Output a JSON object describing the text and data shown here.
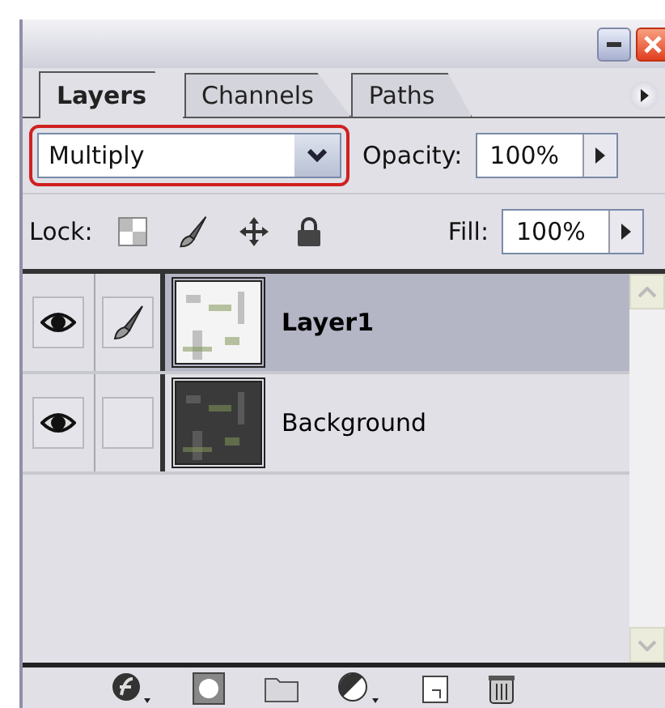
{
  "tabs": [
    {
      "label": "Layers",
      "selected": true
    },
    {
      "label": "Channels",
      "selected": false
    },
    {
      "label": "Paths",
      "selected": false
    }
  ],
  "blend_mode": {
    "value": "Multiply",
    "highlighted": true
  },
  "opacity": {
    "label": "Opacity:",
    "value": "100%"
  },
  "lock": {
    "label": "Lock:"
  },
  "fill": {
    "label": "Fill:",
    "value": "100%"
  },
  "layers": [
    {
      "name": "Layer1",
      "selected": true,
      "visible": true,
      "paint_target": true
    },
    {
      "name": "Background",
      "selected": false,
      "visible": true,
      "paint_target": false
    }
  ]
}
